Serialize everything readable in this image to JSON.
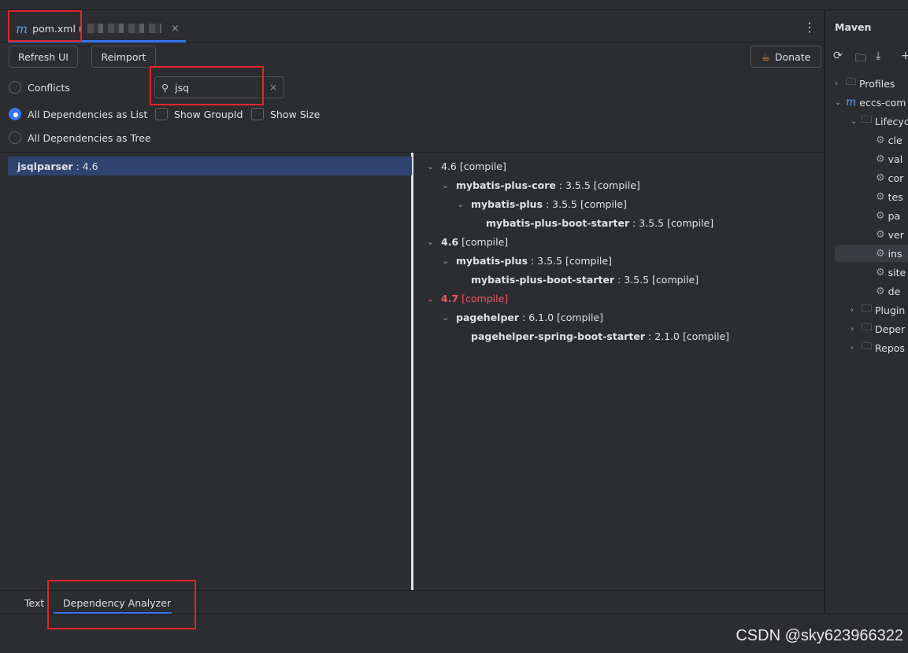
{
  "editor": {
    "tab": {
      "icon": "maven-m-icon",
      "name": "pom.xml (",
      "close": "×"
    },
    "more_menu": "⋮",
    "toolbar": {
      "refresh_label": "Refresh UI",
      "reimport_label": "Reimport",
      "donate_label": "Donate"
    },
    "view_mode": {
      "conflicts_label": "Conflicts",
      "list_label": "All Dependencies as List",
      "tree_label": "All Dependencies as Tree",
      "selected": "All Dependencies as List"
    },
    "search": {
      "value": "jsq",
      "clear": "×"
    },
    "options": {
      "show_groupid_label": "Show GroupId",
      "show_size_label": "Show Size"
    },
    "list": [
      {
        "name": "jsqlparser",
        "version": " : 4.6"
      }
    ],
    "tree": [
      {
        "level": 0,
        "chev": "⌄",
        "name": "",
        "version": "4.6 [compile]",
        "bold_name": false,
        "conflict": false
      },
      {
        "level": 1,
        "chev": "⌄",
        "name": "mybatis-plus-core",
        "version": " : 3.5.5 [compile]",
        "conflict": false
      },
      {
        "level": 2,
        "chev": "⌄",
        "name": "mybatis-plus",
        "version": " : 3.5.5 [compile]",
        "conflict": false
      },
      {
        "level": 3,
        "chev": "",
        "name": "mybatis-plus-boot-starter",
        "version": " : 3.5.5 [compile]",
        "conflict": false
      },
      {
        "level": 0,
        "chev": "⌄",
        "name": "4.6",
        "version": " [compile]",
        "conflict": false
      },
      {
        "level": 1,
        "chev": "⌄",
        "name": "mybatis-plus",
        "version": " : 3.5.5 [compile]",
        "conflict": false
      },
      {
        "level": 2,
        "chev": "",
        "name": "mybatis-plus-boot-starter",
        "version": " : 3.5.5 [compile]",
        "conflict": false
      },
      {
        "level": 0,
        "chev": "⌄",
        "name": "4.7",
        "version": " [compile]",
        "conflict": true
      },
      {
        "level": 1,
        "chev": "⌄",
        "name": "pagehelper",
        "version": " : 6.1.0 [compile]",
        "conflict": false
      },
      {
        "level": 2,
        "chev": "",
        "name": "pagehelper-spring-boot-starter",
        "version": " : 2.1.0 [compile]",
        "conflict": false
      }
    ],
    "bottom_tabs": {
      "text_label": "Text",
      "analyzer_label": "Dependency Analyzer",
      "active": "Dependency Analyzer"
    }
  },
  "maven": {
    "title": "Maven",
    "tree": [
      {
        "label": "Profiles",
        "chev": "›",
        "icon": "folder"
      },
      {
        "label": "eccs-com",
        "chev": "⌄",
        "icon": "maven"
      },
      {
        "label": "Lifecyc",
        "chev": "⌄",
        "icon": "folder"
      },
      {
        "label": "cle",
        "icon": "gear"
      },
      {
        "label": "val",
        "icon": "gear"
      },
      {
        "label": "cor",
        "icon": "gear"
      },
      {
        "label": "tes",
        "icon": "gear"
      },
      {
        "label": "pa",
        "icon": "gear"
      },
      {
        "label": "ver",
        "icon": "gear"
      },
      {
        "label": "ins",
        "icon": "gear",
        "selected": true
      },
      {
        "label": "site",
        "icon": "gear"
      },
      {
        "label": "de",
        "icon": "gear"
      },
      {
        "label": "Plugin",
        "chev": "›",
        "icon": "folder"
      },
      {
        "label": "Deper",
        "chev": "›",
        "icon": "folder"
      },
      {
        "label": "Repos",
        "chev": "›",
        "icon": "folder"
      }
    ]
  },
  "watermark": "CSDN @sky623966322",
  "colors": {
    "accent": "#3574f0",
    "conflict": "#f75464",
    "selection": "#2e436e",
    "highlight_box": "#e0262b"
  }
}
